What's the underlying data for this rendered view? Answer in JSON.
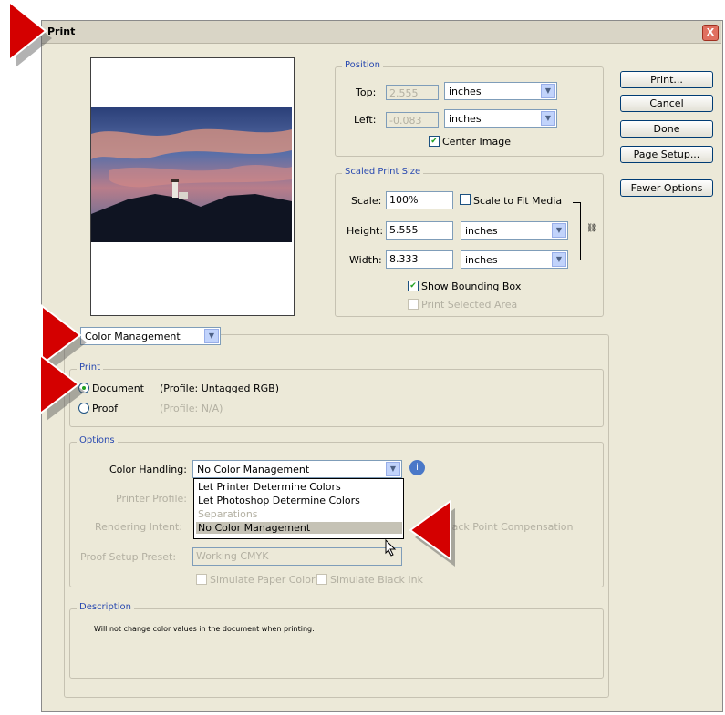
{
  "window": {
    "title": "Print",
    "close_label": "X"
  },
  "buttons": {
    "print": "Print...",
    "cancel": "Cancel",
    "done": "Done",
    "page_setup": "Page Setup...",
    "fewer_options": "Fewer Options"
  },
  "position": {
    "legend": "Position",
    "top_label": "Top:",
    "top_value": "2.555",
    "top_unit": "inches",
    "left_label": "Left:",
    "left_value": "-0.083",
    "left_unit": "inches",
    "center_image_label": "Center Image",
    "center_image_checked": true
  },
  "scaled_print_size": {
    "legend": "Scaled Print Size",
    "scale_label": "Scale:",
    "scale_value": "100%",
    "scale_to_fit_label": "Scale to Fit Media",
    "height_label": "Height:",
    "height_value": "5.555",
    "height_unit": "inches",
    "width_label": "Width:",
    "width_value": "8.333",
    "width_unit": "inches",
    "show_bounding_box_label": "Show Bounding Box",
    "print_selected_area_label": "Print Selected Area"
  },
  "section_select": {
    "value": "Color Management"
  },
  "print_group": {
    "legend": "Print",
    "document_label": "Document",
    "document_profile": "(Profile: Untagged RGB)",
    "proof_label": "Proof",
    "proof_profile": "(Profile: N/A)"
  },
  "options": {
    "legend": "Options",
    "color_handling_label": "Color Handling:",
    "color_handling_value": "No Color Management",
    "printer_profile_label": "Printer Profile:",
    "rendering_intent_label": "Rendering Intent:",
    "black_point_label": "Black Point Compensation",
    "proof_setup_label": "Proof Setup Preset:",
    "proof_setup_value": "Working CMYK",
    "simulate_paper_label": "Simulate Paper Color",
    "simulate_black_label": "Simulate Black Ink",
    "dropdown_items": [
      "Let Printer Determine Colors",
      "Let Photoshop Determine Colors",
      "Separations",
      "No Color Management"
    ]
  },
  "description": {
    "legend": "Description",
    "text": "Will not change color values in the document when printing."
  },
  "colors": {
    "marker_red": "#d40000",
    "dialog_bg": "#ece9d8",
    "legend_blue": "#2a4ab0"
  }
}
